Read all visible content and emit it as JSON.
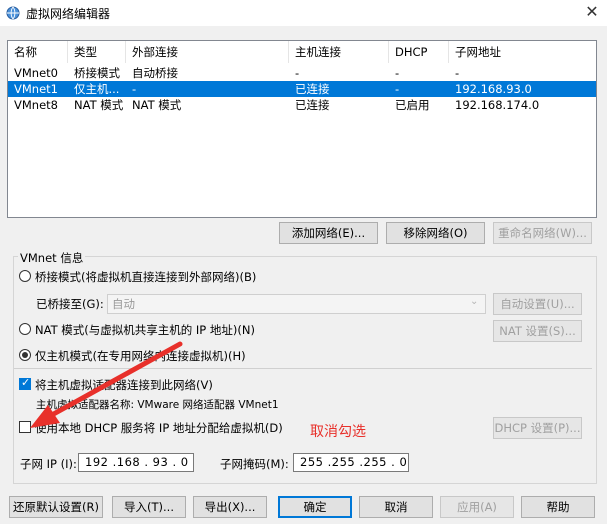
{
  "window": {
    "title": "虚拟网络编辑器",
    "close_icon": "close-icon"
  },
  "table": {
    "columns": [
      "名称",
      "类型",
      "外部连接",
      "主机连接",
      "DHCP",
      "子网地址"
    ],
    "rows": [
      {
        "name": "VMnet0",
        "type": "桥接模式",
        "external": "自动桥接",
        "host": "-",
        "dhcp": "-",
        "subnet": "-",
        "selected": false
      },
      {
        "name": "VMnet1",
        "type": "仅主机...",
        "external": "-",
        "host": "已连接",
        "dhcp": "-",
        "subnet": "192.168.93.0",
        "selected": true
      },
      {
        "name": "VMnet8",
        "type": "NAT 模式",
        "external": "NAT 模式",
        "host": "已连接",
        "dhcp": "已启用",
        "subnet": "192.168.174.0",
        "selected": false
      }
    ]
  },
  "list_buttons": {
    "add": "添加网络(E)...",
    "remove": "移除网络(O)",
    "rename": "重命名网络(W)..."
  },
  "vmnet_info": {
    "label": "VMnet 信息",
    "bridged_radio": "桥接模式(将虚拟机直接连接到外部网络)(B)",
    "bridged_to_label": "已桥接至(G):",
    "bridged_to_value": "自动",
    "auto_settings": "自动设置(U)...",
    "nat_radio": "NAT 模式(与虚拟机共享主机的 IP 地址)(N)",
    "nat_settings": "NAT 设置(S)...",
    "hostonly_radio": "仅主机模式(在专用网络内连接虚拟机)(H)",
    "selected_mode": "hostonly",
    "connect_adapter_chk": "将主机虚拟适配器连接到此网络(V)",
    "connect_adapter_checked": true,
    "adapter_name_text": "主机虚拟适配器名称: VMware 网络适配器 VMnet1",
    "dhcp_chk": "使用本地 DHCP 服务将 IP 地址分配给虚拟机(D)",
    "dhcp_checked": false,
    "dhcp_settings": "DHCP 设置(P)...",
    "annotation": "取消勾选",
    "subnet_ip_label": "子网 IP (I):",
    "subnet_ip_value": "192 .168 . 93 . 0",
    "subnet_mask_label": "子网掩码(M):",
    "subnet_mask_value": "255 .255 .255 . 0"
  },
  "footer": {
    "restore": "还原默认设置(R)",
    "import": "导入(T)...",
    "export": "导出(X)...",
    "ok": "确定",
    "cancel": "取消",
    "apply": "应用(A)",
    "help": "帮助"
  },
  "colors": {
    "selection": "#0078d7",
    "annotation": "#e8302a",
    "arrow": "#e8302a"
  }
}
